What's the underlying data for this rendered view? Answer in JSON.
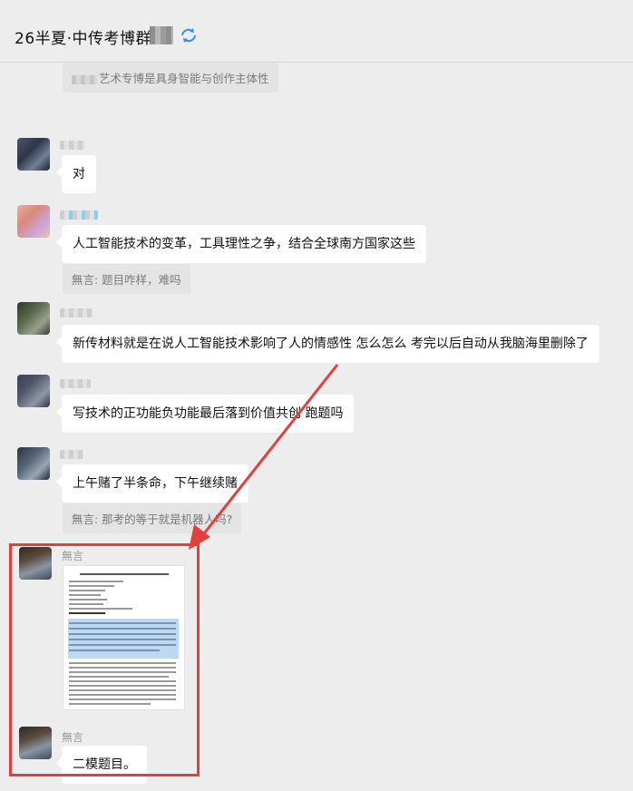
{
  "header": {
    "title": "26半夏·中传考博群"
  },
  "messages": [
    {
      "quote": "艺术专博是具身智能与创作主体性"
    },
    {
      "text": "对"
    },
    {
      "text": "人工智能技术的变革，工具理性之争，结合全球南方国家这些",
      "quote": "無言: 题目咋样，难吗"
    },
    {
      "text": "新传材料就是在说人工智能技术影响了人的情感性 怎么怎么 考完以后自动从我脑海里删除了"
    },
    {
      "text": "写技术的正功能负功能最后落到价值共创 跑题吗"
    },
    {
      "text": "上午赌了半条命，下午继续赌",
      "quote": "無言: 那考的等于就是机器人吗?"
    },
    {
      "sender": "無言",
      "attachment": "document-image"
    },
    {
      "sender": "無言",
      "text": "二模题目。"
    }
  ],
  "colors": {
    "background": "#ededed",
    "bubble": "#ffffff",
    "quote": "#e4e4e4",
    "annotation_red": "#e53e3e",
    "highlight_blue": "#bcd9f3"
  },
  "icons": {
    "sync": "sync-icon",
    "avatar": "avatar"
  }
}
